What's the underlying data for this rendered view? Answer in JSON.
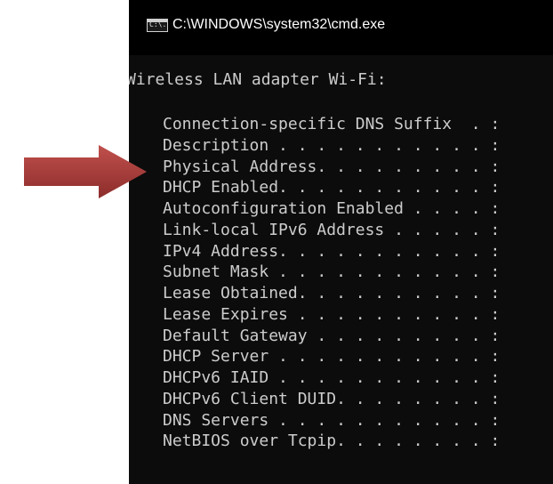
{
  "window": {
    "title": "C:\\WINDOWS\\system32\\cmd.exe",
    "icon": "cmd-icon",
    "icon_text": "C:\\."
  },
  "console": {
    "heading": "Wireless LAN adapter Wi-Fi:",
    "entries": [
      "Connection-specific DNS Suffix  . :",
      "Description . . . . . . . . . . . :",
      "Physical Address. . . . . . . . . :",
      "DHCP Enabled. . . . . . . . . . . :",
      "Autoconfiguration Enabled . . . . :",
      "Link-local IPv6 Address . . . . . :",
      "IPv4 Address. . . . . . . . . . . :",
      "Subnet Mask . . . . . . . . . . . :",
      "Lease Obtained. . . . . . . . . . :",
      "Lease Expires . . . . . . . . . . :",
      "Default Gateway . . . . . . . . . :",
      "DHCP Server . . . . . . . . . . . :",
      "DHCPv6 IAID . . . . . . . . . . . :",
      "DHCPv6 Client DUID. . . . . . . . :",
      "DNS Servers . . . . . . . . . . . :",
      "NetBIOS over Tcpip. . . . . . . . :"
    ]
  },
  "annotation": {
    "icon": "arrow-right-icon",
    "color": "#c0504d",
    "color_dark": "#8c2d2b",
    "points_to": "Physical Address. . . . . . . . . :"
  },
  "colors": {
    "console_bg": "#0c0c0c",
    "console_text": "#cccccc",
    "titlebar_bg": "#000000",
    "title_text": "#ffffff"
  }
}
